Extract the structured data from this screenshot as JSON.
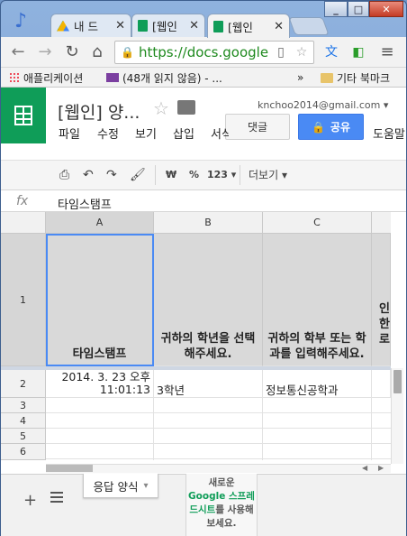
{
  "browser": {
    "tabs": [
      {
        "label": "내 드",
        "icon": "google-drive-icon"
      },
      {
        "label": "[웹인",
        "icon": "google-forms-icon"
      },
      {
        "label": "[웹인",
        "icon": "google-sheets-icon"
      }
    ],
    "url": "https://docs.google",
    "bookmarks": {
      "apps": "애플리케이션",
      "mail": "(48개 읽지 않음) - ...",
      "overflow": "»",
      "other": "기타 북마크"
    }
  },
  "docs": {
    "title": "[웹인] 양...",
    "email": "knchoo2014@gmail.com",
    "comment_label": "댓글",
    "share_label": "공유",
    "menu": [
      "파일",
      "수정",
      "보기",
      "삽입",
      "서식",
      "도움말"
    ]
  },
  "format_toolbar": {
    "currency": "₩",
    "percent": "%",
    "number_format": "123",
    "more": "더보기"
  },
  "formula_bar": {
    "fx": "fx",
    "content": "타임스탬프"
  },
  "grid": {
    "columns": [
      "A",
      "B",
      "C"
    ],
    "rows": [
      "1",
      "2",
      "3",
      "4",
      "5",
      "6"
    ],
    "header_row": {
      "a": "타임스탬프",
      "b": "귀하의 학년을 선택해주세요.",
      "c": "귀하의 학부 또는 학과를 입력해주세요.",
      "d": "인한로"
    },
    "row2": {
      "a_date": "2014. 3. 23 오후",
      "a_time": "11:01:13",
      "b": "3학년",
      "c": "정보통신공학과"
    }
  },
  "sheet_bar": {
    "add": "+",
    "tab_label": "응답 양식",
    "promo_1": "새로운",
    "promo_2": "Google 스프레드시트",
    "promo_3": "를 사용해 보세요."
  },
  "colors": {
    "sheets_green": "#0f9d58",
    "share_blue": "#4a8af4",
    "secure_url_green": "#1f8a1f"
  }
}
